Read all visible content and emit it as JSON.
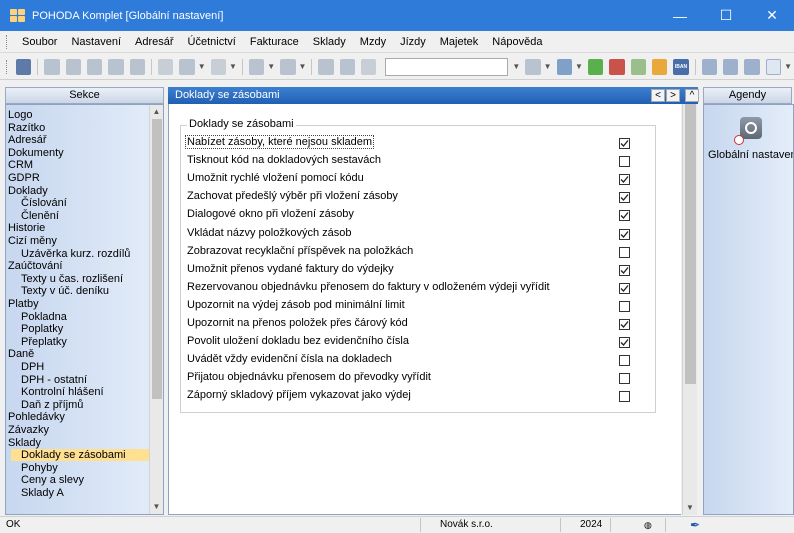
{
  "window": {
    "title": "POHODA Komplet  [Globální nastavení]",
    "minimize": "—",
    "maximize": "☐",
    "close": "✕"
  },
  "menu": [
    "Soubor",
    "Nastavení",
    "Adresář",
    "Účetnictví",
    "Fakturace",
    "Sklady",
    "Mzdy",
    "Jízdy",
    "Majetek",
    "Nápověda"
  ],
  "toolbar": {
    "iban_label": "IBAN"
  },
  "sekce": {
    "title": "Sekce",
    "items": [
      {
        "label": "Logo",
        "level": 0
      },
      {
        "label": "Razítko",
        "level": 0
      },
      {
        "label": "Adresář",
        "level": 0
      },
      {
        "label": "Dokumenty",
        "level": 0
      },
      {
        "label": "CRM",
        "level": 0
      },
      {
        "label": "GDPR",
        "level": 0
      },
      {
        "label": "Doklady",
        "level": 0
      },
      {
        "label": "Číslování",
        "level": 1
      },
      {
        "label": "Členění",
        "level": 1
      },
      {
        "label": "Historie",
        "level": 0
      },
      {
        "label": "Cizí měny",
        "level": 0
      },
      {
        "label": "Uzávěrka kurz. rozdílů",
        "level": 1
      },
      {
        "label": "Zaúčtování",
        "level": 0
      },
      {
        "label": "Texty u čas. rozlišení",
        "level": 1
      },
      {
        "label": "Texty v úč. deníku",
        "level": 1
      },
      {
        "label": "Platby",
        "level": 0
      },
      {
        "label": "Pokladna",
        "level": 1
      },
      {
        "label": "Poplatky",
        "level": 1
      },
      {
        "label": "Přeplatky",
        "level": 1
      },
      {
        "label": "Daně",
        "level": 0
      },
      {
        "label": "DPH",
        "level": 1
      },
      {
        "label": "DPH - ostatní",
        "level": 1
      },
      {
        "label": "Kontrolní hlášení",
        "level": 1
      },
      {
        "label": "Daň z příjmů",
        "level": 1
      },
      {
        "label": "Pohledávky",
        "level": 0
      },
      {
        "label": "Závazky",
        "level": 0
      },
      {
        "label": "Sklady",
        "level": 0
      },
      {
        "label": "Doklady se zásobami",
        "level": 1,
        "selected": true
      },
      {
        "label": "Pohyby",
        "level": 1
      },
      {
        "label": "Ceny a slevy",
        "level": 1
      },
      {
        "label": "Sklady A",
        "level": 1
      }
    ]
  },
  "main": {
    "header": "Doklady se zásobami",
    "nav_prev": "<",
    "nav_next": ">",
    "group_title": "Doklady se zásobami",
    "options": [
      {
        "label": "Nabízet zásoby, které nejsou skladem",
        "checked": true,
        "focused": true
      },
      {
        "label": "Tisknout kód na dokladových sestavách",
        "checked": false
      },
      {
        "label": "Umožnit rychlé vložení pomocí kódu",
        "checked": true
      },
      {
        "label": "Zachovat předešlý výběr při vložení zásoby",
        "checked": true
      },
      {
        "label": "Dialogové okno při vložení zásoby",
        "checked": true
      },
      {
        "label": "Vkládat názvy položkových zásob",
        "checked": true
      },
      {
        "label": "Zobrazovat recyklační příspěvek na položkách",
        "checked": false
      },
      {
        "label": "Umožnit přenos vydané faktury do výdejky",
        "checked": true
      },
      {
        "label": "Rezervovanou objednávku přenosem do faktury v odloženém výdeji vyřídit",
        "checked": true
      },
      {
        "label": "Upozornit na výdej zásob pod minimální limit",
        "checked": false
      },
      {
        "label": "Upozornit na přenos položek přes čárový kód",
        "checked": true
      },
      {
        "label": "Povolit uložení dokladu bez evidenčního čísla",
        "checked": true
      },
      {
        "label": "Uvádět vždy evidenční čísla na dokladech",
        "checked": false
      },
      {
        "label": "Přijatou objednávku přenosem do převodky vyřídit",
        "checked": false
      },
      {
        "label": "Záporný skladový příjem vykazovat jako výdej",
        "checked": false
      }
    ]
  },
  "agendy": {
    "title": "Agendy",
    "item_label": "Globální nastavení"
  },
  "status": {
    "left": "OK",
    "user": "Novák  s.r.o.",
    "year": "2024"
  },
  "colors": {
    "titlebar": "#2f7bd9",
    "header": "#2060b4",
    "selected": "#ffdf90",
    "panel": "#d4e1f4"
  }
}
